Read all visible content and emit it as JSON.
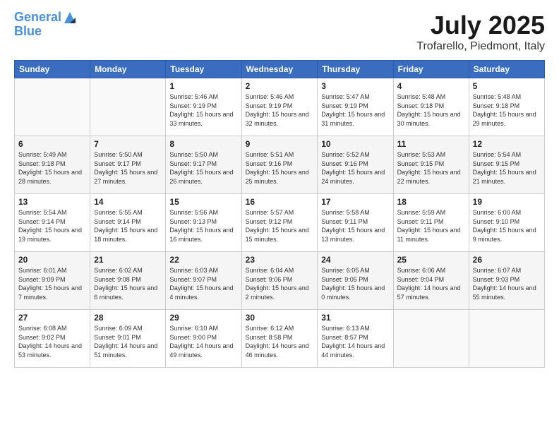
{
  "header": {
    "logo_line1": "General",
    "logo_line2": "Blue",
    "month_year": "July 2025",
    "location": "Trofarello, Piedmont, Italy"
  },
  "weekdays": [
    "Sunday",
    "Monday",
    "Tuesday",
    "Wednesday",
    "Thursday",
    "Friday",
    "Saturday"
  ],
  "weeks": [
    [
      {
        "day": "",
        "sunrise": "",
        "sunset": "",
        "daylight": ""
      },
      {
        "day": "",
        "sunrise": "",
        "sunset": "",
        "daylight": ""
      },
      {
        "day": "1",
        "sunrise": "Sunrise: 5:46 AM",
        "sunset": "Sunset: 9:19 PM",
        "daylight": "Daylight: 15 hours and 33 minutes."
      },
      {
        "day": "2",
        "sunrise": "Sunrise: 5:46 AM",
        "sunset": "Sunset: 9:19 PM",
        "daylight": "Daylight: 15 hours and 32 minutes."
      },
      {
        "day": "3",
        "sunrise": "Sunrise: 5:47 AM",
        "sunset": "Sunset: 9:19 PM",
        "daylight": "Daylight: 15 hours and 31 minutes."
      },
      {
        "day": "4",
        "sunrise": "Sunrise: 5:48 AM",
        "sunset": "Sunset: 9:18 PM",
        "daylight": "Daylight: 15 hours and 30 minutes."
      },
      {
        "day": "5",
        "sunrise": "Sunrise: 5:48 AM",
        "sunset": "Sunset: 9:18 PM",
        "daylight": "Daylight: 15 hours and 29 minutes."
      }
    ],
    [
      {
        "day": "6",
        "sunrise": "Sunrise: 5:49 AM",
        "sunset": "Sunset: 9:18 PM",
        "daylight": "Daylight: 15 hours and 28 minutes."
      },
      {
        "day": "7",
        "sunrise": "Sunrise: 5:50 AM",
        "sunset": "Sunset: 9:17 PM",
        "daylight": "Daylight: 15 hours and 27 minutes."
      },
      {
        "day": "8",
        "sunrise": "Sunrise: 5:50 AM",
        "sunset": "Sunset: 9:17 PM",
        "daylight": "Daylight: 15 hours and 26 minutes."
      },
      {
        "day": "9",
        "sunrise": "Sunrise: 5:51 AM",
        "sunset": "Sunset: 9:16 PM",
        "daylight": "Daylight: 15 hours and 25 minutes."
      },
      {
        "day": "10",
        "sunrise": "Sunrise: 5:52 AM",
        "sunset": "Sunset: 9:16 PM",
        "daylight": "Daylight: 15 hours and 24 minutes."
      },
      {
        "day": "11",
        "sunrise": "Sunrise: 5:53 AM",
        "sunset": "Sunset: 9:15 PM",
        "daylight": "Daylight: 15 hours and 22 minutes."
      },
      {
        "day": "12",
        "sunrise": "Sunrise: 5:54 AM",
        "sunset": "Sunset: 9:15 PM",
        "daylight": "Daylight: 15 hours and 21 minutes."
      }
    ],
    [
      {
        "day": "13",
        "sunrise": "Sunrise: 5:54 AM",
        "sunset": "Sunset: 9:14 PM",
        "daylight": "Daylight: 15 hours and 19 minutes."
      },
      {
        "day": "14",
        "sunrise": "Sunrise: 5:55 AM",
        "sunset": "Sunset: 9:14 PM",
        "daylight": "Daylight: 15 hours and 18 minutes."
      },
      {
        "day": "15",
        "sunrise": "Sunrise: 5:56 AM",
        "sunset": "Sunset: 9:13 PM",
        "daylight": "Daylight: 15 hours and 16 minutes."
      },
      {
        "day": "16",
        "sunrise": "Sunrise: 5:57 AM",
        "sunset": "Sunset: 9:12 PM",
        "daylight": "Daylight: 15 hours and 15 minutes."
      },
      {
        "day": "17",
        "sunrise": "Sunrise: 5:58 AM",
        "sunset": "Sunset: 9:11 PM",
        "daylight": "Daylight: 15 hours and 13 minutes."
      },
      {
        "day": "18",
        "sunrise": "Sunrise: 5:59 AM",
        "sunset": "Sunset: 9:11 PM",
        "daylight": "Daylight: 15 hours and 11 minutes."
      },
      {
        "day": "19",
        "sunrise": "Sunrise: 6:00 AM",
        "sunset": "Sunset: 9:10 PM",
        "daylight": "Daylight: 15 hours and 9 minutes."
      }
    ],
    [
      {
        "day": "20",
        "sunrise": "Sunrise: 6:01 AM",
        "sunset": "Sunset: 9:09 PM",
        "daylight": "Daylight: 15 hours and 7 minutes."
      },
      {
        "day": "21",
        "sunrise": "Sunrise: 6:02 AM",
        "sunset": "Sunset: 9:08 PM",
        "daylight": "Daylight: 15 hours and 6 minutes."
      },
      {
        "day": "22",
        "sunrise": "Sunrise: 6:03 AM",
        "sunset": "Sunset: 9:07 PM",
        "daylight": "Daylight: 15 hours and 4 minutes."
      },
      {
        "day": "23",
        "sunrise": "Sunrise: 6:04 AM",
        "sunset": "Sunset: 9:06 PM",
        "daylight": "Daylight: 15 hours and 2 minutes."
      },
      {
        "day": "24",
        "sunrise": "Sunrise: 6:05 AM",
        "sunset": "Sunset: 9:05 PM",
        "daylight": "Daylight: 15 hours and 0 minutes."
      },
      {
        "day": "25",
        "sunrise": "Sunrise: 6:06 AM",
        "sunset": "Sunset: 9:04 PM",
        "daylight": "Daylight: 14 hours and 57 minutes."
      },
      {
        "day": "26",
        "sunrise": "Sunrise: 6:07 AM",
        "sunset": "Sunset: 9:03 PM",
        "daylight": "Daylight: 14 hours and 55 minutes."
      }
    ],
    [
      {
        "day": "27",
        "sunrise": "Sunrise: 6:08 AM",
        "sunset": "Sunset: 9:02 PM",
        "daylight": "Daylight: 14 hours and 53 minutes."
      },
      {
        "day": "28",
        "sunrise": "Sunrise: 6:09 AM",
        "sunset": "Sunset: 9:01 PM",
        "daylight": "Daylight: 14 hours and 51 minutes."
      },
      {
        "day": "29",
        "sunrise": "Sunrise: 6:10 AM",
        "sunset": "Sunset: 9:00 PM",
        "daylight": "Daylight: 14 hours and 49 minutes."
      },
      {
        "day": "30",
        "sunrise": "Sunrise: 6:12 AM",
        "sunset": "Sunset: 8:58 PM",
        "daylight": "Daylight: 14 hours and 46 minutes."
      },
      {
        "day": "31",
        "sunrise": "Sunrise: 6:13 AM",
        "sunset": "Sunset: 8:57 PM",
        "daylight": "Daylight: 14 hours and 44 minutes."
      },
      {
        "day": "",
        "sunrise": "",
        "sunset": "",
        "daylight": ""
      },
      {
        "day": "",
        "sunrise": "",
        "sunset": "",
        "daylight": ""
      }
    ]
  ]
}
